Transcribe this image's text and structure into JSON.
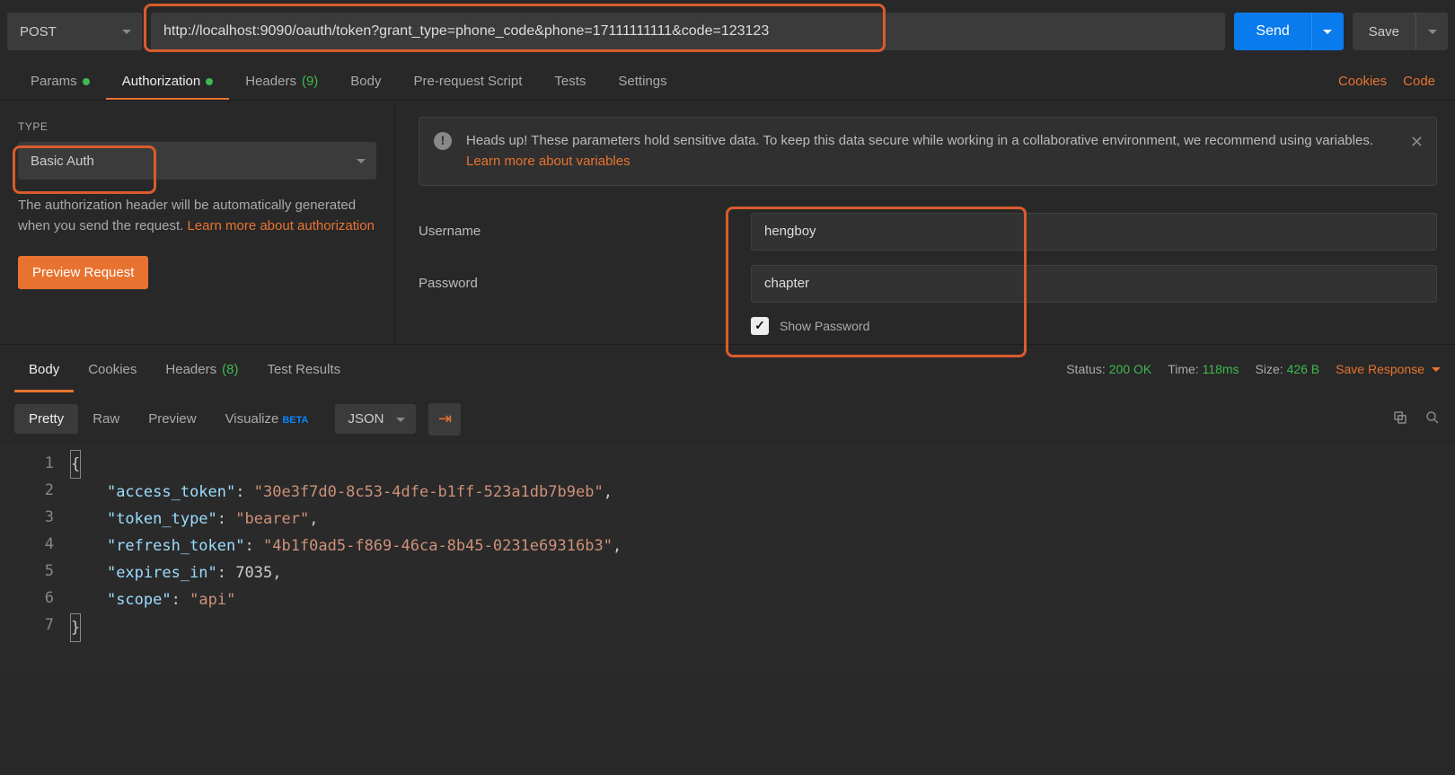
{
  "request": {
    "method": "POST",
    "url": "http://localhost:9090/oauth/token?grant_type=phone_code&phone=17111111111&code=123123",
    "send": "Send",
    "save": "Save"
  },
  "tabs": {
    "params": "Params",
    "authorization": "Authorization",
    "headers": "Headers",
    "headers_count": "(9)",
    "body": "Body",
    "prerequest": "Pre-request Script",
    "tests": "Tests",
    "settings": "Settings",
    "cookies": "Cookies",
    "code": "Code"
  },
  "auth": {
    "type_label": "TYPE",
    "type_value": "Basic Auth",
    "help1": "The authorization header will be automatically generated when you send the request. ",
    "help_link": "Learn more about authorization",
    "preview": "Preview Request"
  },
  "alert": {
    "text1": "Heads up! These parameters hold sensitive data. To keep this data secure while working in a collaborative environment, we recommend using variables. ",
    "link": "Learn more about variables"
  },
  "fields": {
    "username_label": "Username",
    "username_value": "hengboy",
    "password_label": "Password",
    "password_value": "chapter",
    "show_password": "Show Password"
  },
  "response": {
    "tabs": {
      "body": "Body",
      "cookies": "Cookies",
      "headers": "Headers",
      "headers_count": "(8)",
      "test_results": "Test Results"
    },
    "status_label": "Status:",
    "status_value": "200 OK",
    "time_label": "Time:",
    "time_value": "118ms",
    "size_label": "Size:",
    "size_value": "426 B",
    "save_response": "Save Response"
  },
  "toolbar": {
    "pretty": "Pretty",
    "raw": "Raw",
    "preview": "Preview",
    "visualize": "Visualize",
    "beta": "BETA",
    "json": "JSON"
  },
  "json_body": {
    "lines": [
      "1",
      "2",
      "3",
      "4",
      "5",
      "6",
      "7"
    ],
    "access_token": "30e3f7d0-8c53-4dfe-b1ff-523a1db7b9eb",
    "token_type": "bearer",
    "refresh_token": "4b1f0ad5-f869-46ca-8b45-0231e69316b3",
    "expires_in": "7035",
    "scope": "api"
  }
}
